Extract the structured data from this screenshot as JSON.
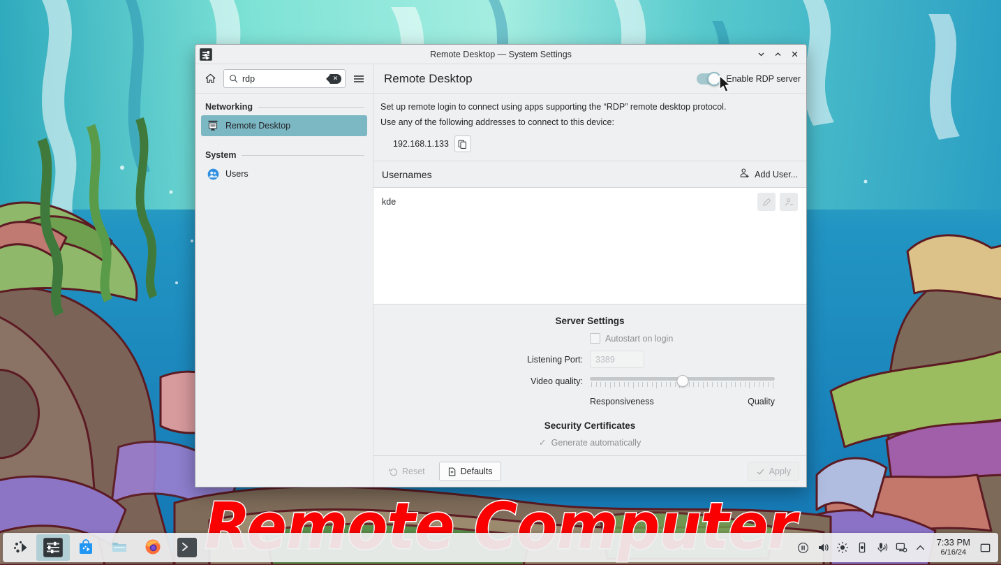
{
  "window": {
    "title": "Remote Desktop — System Settings",
    "icon": "system-settings-icon",
    "controls": {
      "minimize": "chevron-down-icon",
      "maximize": "chevron-up-icon",
      "close": "close-icon"
    }
  },
  "toolbar": {
    "home_icon": "home-icon",
    "menu_icon": "hamburger-menu-icon",
    "search": {
      "value": "rdp",
      "placeholder": "Search",
      "icon": "search-icon",
      "clear_icon": "clear-text-icon"
    }
  },
  "page": {
    "title": "Remote Desktop",
    "toggle_label": "Enable RDP server",
    "toggle_state": "on",
    "accent_color": "#7cb7c4"
  },
  "sidebar": {
    "categories": [
      {
        "label": "Networking",
        "items": [
          {
            "label": "Remote Desktop",
            "icon": "remote-desktop-icon",
            "active": true
          }
        ]
      },
      {
        "label": "System",
        "items": [
          {
            "label": "Users",
            "icon": "users-icon",
            "active": false
          }
        ]
      }
    ]
  },
  "description": {
    "line1": "Set up remote login to connect using apps supporting the “RDP” remote desktop protocol.",
    "line2": "Use any of the following addresses to connect to this device:",
    "address": "192.168.1.133",
    "copy_icon": "copy-icon"
  },
  "usernames": {
    "header": "Usernames",
    "add_user_label": "Add User...",
    "add_user_icon": "add-user-icon",
    "rows": [
      {
        "name": "kde",
        "edit_icon": "pencil-icon",
        "remove_icon": "remove-user-icon"
      }
    ]
  },
  "server_settings": {
    "title": "Server Settings",
    "autostart": {
      "label": "Autostart on login",
      "checked": false
    },
    "port": {
      "label": "Listening Port:",
      "value": "3389"
    },
    "video_quality": {
      "label": "Video quality:",
      "left_end": "Responsiveness",
      "right_end": "Quality",
      "position_percent": 50
    }
  },
  "security": {
    "title": "Security Certificates",
    "generate": {
      "label": "Generate automatically",
      "checked": true
    }
  },
  "footer": {
    "reset": {
      "label": "Reset",
      "icon": "undo-icon",
      "enabled": false
    },
    "defaults": {
      "label": "Defaults",
      "icon": "document-revert-icon",
      "enabled": true
    },
    "apply": {
      "label": "Apply",
      "icon": "check-icon",
      "enabled": false
    }
  },
  "overlay": {
    "text": "Remote Computer",
    "color": "#fa0000",
    "outline": "#ffffff"
  },
  "taskbar": {
    "launcher": "kde-application-launcher-icon",
    "apps": [
      {
        "name": "system-settings",
        "icon": "system-settings-icon",
        "active": true
      },
      {
        "name": "discover",
        "icon": "software-center-icon",
        "active": false
      },
      {
        "name": "dolphin",
        "icon": "file-manager-icon",
        "active": false
      },
      {
        "name": "firefox",
        "icon": "firefox-icon",
        "active": false
      },
      {
        "name": "konsole",
        "icon": "terminal-icon",
        "active": false
      }
    ],
    "tray": [
      {
        "name": "media-player",
        "icon": "pause-icon"
      },
      {
        "name": "volume",
        "icon": "speaker-icon"
      },
      {
        "name": "brightness",
        "icon": "sun-icon"
      },
      {
        "name": "battery",
        "icon": "battery-icon"
      },
      {
        "name": "microphone",
        "icon": "microphone-icon"
      },
      {
        "name": "network",
        "icon": "network-display-icon"
      },
      {
        "name": "expand-tray",
        "icon": "chevron-up-icon"
      }
    ],
    "clock": {
      "time": "7:33 PM",
      "date": "6/16/24"
    },
    "show_desktop": "show-desktop-icon"
  }
}
